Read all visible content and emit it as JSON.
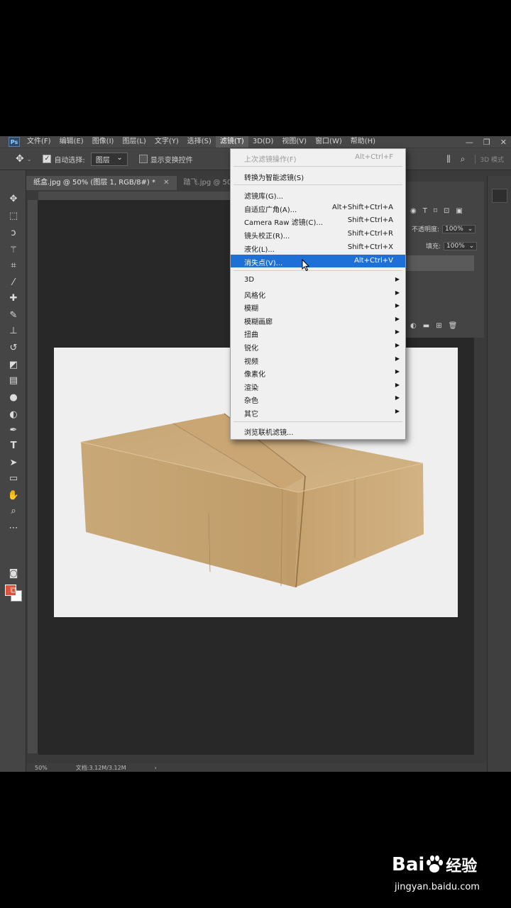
{
  "app": {
    "logo": "Ps",
    "menu": [
      "文件(F)",
      "编辑(E)",
      "图像(I)",
      "图层(L)",
      "文字(Y)",
      "选择(S)",
      "滤镜(T)",
      "3D(D)",
      "视图(V)",
      "窗口(W)",
      "帮助(H)"
    ],
    "active_menu_index": 6,
    "window_controls": [
      "—",
      "❐",
      "✕"
    ]
  },
  "options_bar": {
    "auto_select_label": "自动选择:",
    "auto_select_checked": true,
    "auto_select_target": "图层",
    "show_transform_label": "显示变换控件",
    "show_transform_checked": false,
    "mode_3d": "3D 模式"
  },
  "tabs": [
    {
      "label": "纸盒.jpg @ 50% (图层 1, RGB/8#) *",
      "active": true
    },
    {
      "label": "踏飞.jpg @ 50",
      "active": false
    }
  ],
  "layers_panel": {
    "opacity_label": "不透明度:",
    "opacity_value": "100%",
    "fill_label": "填充:",
    "fill_value": "100%"
  },
  "status_bar": {
    "zoom": "50%",
    "doc_info": "文档:3.12M/3.12M"
  },
  "filter_menu": {
    "items": [
      {
        "label": "上次滤镜操作(F)",
        "shortcut": "Alt+Ctrl+F",
        "disabled": true
      },
      {
        "separator": true
      },
      {
        "label": "转换为智能滤镜(S)"
      },
      {
        "separator": true
      },
      {
        "label": "滤镜库(G)..."
      },
      {
        "label": "自适应广角(A)...",
        "shortcut": "Alt+Shift+Ctrl+A"
      },
      {
        "label": "Camera Raw 滤镜(C)...",
        "shortcut": "Shift+Ctrl+A"
      },
      {
        "label": "镜头校正(R)...",
        "shortcut": "Shift+Ctrl+R"
      },
      {
        "label": "液化(L)...",
        "shortcut": "Shift+Ctrl+X"
      },
      {
        "label": "消失点(V)...",
        "shortcut": "Alt+Ctrl+V",
        "highlight": true
      },
      {
        "separator": true
      },
      {
        "label": "3D",
        "submenu": true
      },
      {
        "label": "风格化",
        "submenu": true
      },
      {
        "label": "模糊",
        "submenu": true
      },
      {
        "label": "模糊画廊",
        "submenu": true
      },
      {
        "label": "扭曲",
        "submenu": true
      },
      {
        "label": "锐化",
        "submenu": true
      },
      {
        "label": "视频",
        "submenu": true
      },
      {
        "label": "像素化",
        "submenu": true
      },
      {
        "label": "渲染",
        "submenu": true
      },
      {
        "label": "杂色",
        "submenu": true
      },
      {
        "label": "其它",
        "submenu": true
      },
      {
        "separator": true
      },
      {
        "label": "浏览联机滤镜..."
      }
    ]
  },
  "watermark": {
    "logo_text": "Bai",
    "logo_text2": "经验",
    "url": "jingyan.baidu.com"
  },
  "colors": {
    "foreground": "#d9543b",
    "background": "#ffffff",
    "highlight": "#1e6fd6"
  }
}
